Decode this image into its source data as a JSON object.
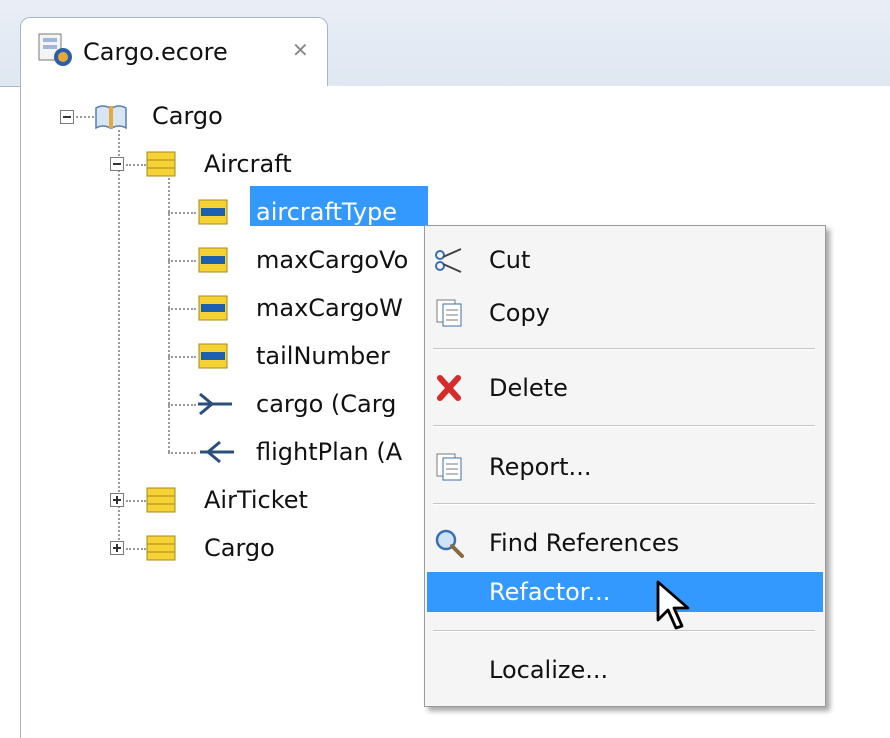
{
  "editor_tab": {
    "title": "Cargo.ecore",
    "close_glyph": "✕",
    "icon": "ecore-file-icon"
  },
  "tree": {
    "root": {
      "label": "Cargo",
      "icon": "epackage-book-icon",
      "expanded": true
    },
    "classes": [
      {
        "label": "Aircraft",
        "icon": "eclass-icon",
        "expanded": true,
        "features": [
          {
            "label": "aircraftType",
            "icon": "eattribute-icon",
            "selected": true
          },
          {
            "label": "maxCargoVo",
            "icon": "eattribute-icon"
          },
          {
            "label": "maxCargoW",
            "icon": "eattribute-icon"
          },
          {
            "label": "tailNumber",
            "icon": "eattribute-icon"
          },
          {
            "label": "cargo (Carg",
            "icon": "ereference-out-icon"
          },
          {
            "label": "flightPlan (A",
            "icon": "ereference-in-icon"
          }
        ]
      },
      {
        "label": "AirTicket",
        "icon": "eclass-icon",
        "expanded": false
      },
      {
        "label": "Cargo",
        "icon": "eclass-icon",
        "expanded": false
      }
    ]
  },
  "context_menu": {
    "items": [
      {
        "label": "Cut",
        "icon": "scissors-icon"
      },
      {
        "label": "Copy",
        "icon": "copy-icon"
      },
      {
        "label": "Delete",
        "icon": "delete-x-icon"
      },
      {
        "label": "Report...",
        "icon": "report-icon"
      },
      {
        "label": "Find References",
        "icon": "magnifier-icon"
      },
      {
        "label": "Refactor...",
        "icon": "",
        "highlighted": true
      },
      {
        "label": "Localize...",
        "icon": ""
      }
    ]
  },
  "colors": {
    "selection": "#3399ff",
    "tab_bar": "#dfe7f2",
    "menu_bg": "#f5f5f5",
    "attribute_yellow": "#f5d233",
    "attribute_blue": "#1f5fb0"
  }
}
